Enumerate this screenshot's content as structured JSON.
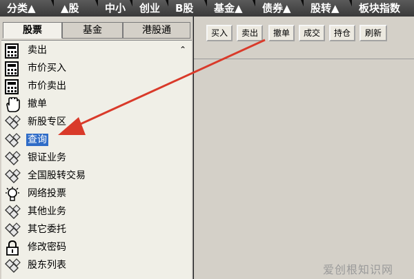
{
  "top_tabs": [
    "分类▲",
    "▲股",
    "中小",
    "创业",
    "B股",
    "基金▲",
    "债券▲",
    "股转▲",
    "板块指数"
  ],
  "panel_tabs": [
    "股票",
    "基金",
    "港股通"
  ],
  "menu_items": [
    {
      "label": "卖出",
      "icon": "calculator-icon"
    },
    {
      "label": "市价买入",
      "icon": "calculator-icon"
    },
    {
      "label": "市价卖出",
      "icon": "calculator-icon"
    },
    {
      "label": "撤单",
      "icon": "hand-icon"
    },
    {
      "label": "新股专区",
      "icon": "diamond-icon"
    },
    {
      "label": "查询",
      "icon": "diamond-icon"
    },
    {
      "label": "银证业务",
      "icon": "diamond-icon"
    },
    {
      "label": "全国股转交易",
      "icon": "diamond-icon"
    },
    {
      "label": "网络投票",
      "icon": "lightbulb-icon"
    },
    {
      "label": "其他业务",
      "icon": "diamond-icon"
    },
    {
      "label": "其它委托",
      "icon": "diamond-icon"
    },
    {
      "label": "修改密码",
      "icon": "lock-icon"
    },
    {
      "label": "股东列表",
      "icon": "diamond-icon"
    }
  ],
  "selected_item": "查询",
  "toolbar_buttons": [
    "买入",
    "卖出",
    "撤单",
    "成交",
    "持仓",
    "刷新"
  ],
  "watermark": "爱创根知识网",
  "colors": {
    "selection": "#2f6cc7",
    "arrow": "#d93a2a",
    "tab_bg": "#4a4a4a"
  }
}
